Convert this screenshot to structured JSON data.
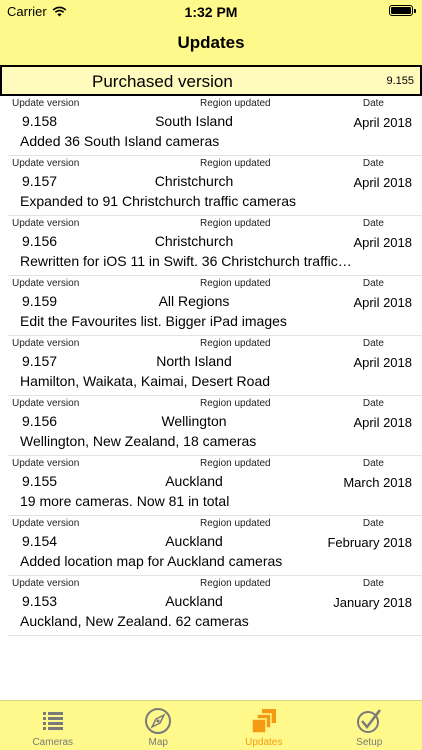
{
  "status": {
    "carrier": "Carrier",
    "time": "1:32 PM"
  },
  "nav": {
    "title": "Updates"
  },
  "purchased": {
    "label": "Purchased version",
    "version": "9.155"
  },
  "headers": {
    "version": "Update version",
    "region": "Region updated",
    "date": "Date"
  },
  "rows": [
    {
      "version": "9.158",
      "region": "South Island",
      "date": "April 2018",
      "desc": "Added 36 South Island cameras"
    },
    {
      "version": "9.157",
      "region": "Christchurch",
      "date": "April 2018",
      "desc": "Expanded to 91 Christchurch traffic cameras"
    },
    {
      "version": "9.156",
      "region": "Christchurch",
      "date": "April 2018",
      "desc": "Rewritten for iOS 11 in Swift. 36 Christchurch traffic…"
    },
    {
      "version": "9.159",
      "region": "All Regions",
      "date": "April 2018",
      "desc": "Edit the Favourites list. Bigger iPad images"
    },
    {
      "version": "9.157",
      "region": "North Island",
      "date": "April 2018",
      "desc": "Hamilton, Waikata, Kaimai, Desert Road"
    },
    {
      "version": "9.156",
      "region": "Wellington",
      "date": "April 2018",
      "desc": "Wellington, New Zealand, 18 cameras"
    },
    {
      "version": "9.155",
      "region": "Auckland",
      "date": "March 2018",
      "desc": "19 more cameras. Now 81 in total"
    },
    {
      "version": "9.154",
      "region": "Auckland",
      "date": "February 2018",
      "desc": "Added location map for Auckland cameras"
    },
    {
      "version": "9.153",
      "region": "Auckland",
      "date": "January 2018",
      "desc": "Auckland, New Zealand.  62 cameras"
    }
  ],
  "tabs": [
    {
      "label": "Cameras",
      "icon": "list-icon"
    },
    {
      "label": "Map",
      "icon": "compass-icon"
    },
    {
      "label": "Updates",
      "icon": "stacked-pages-icon"
    },
    {
      "label": "Setup",
      "icon": "checkmark-circle-icon"
    }
  ],
  "colors": {
    "bar": "#fef98a",
    "purchased_bg": "#fefbbd",
    "active_tab": "#f59b13",
    "inactive_tab": "#7a7a7a"
  }
}
